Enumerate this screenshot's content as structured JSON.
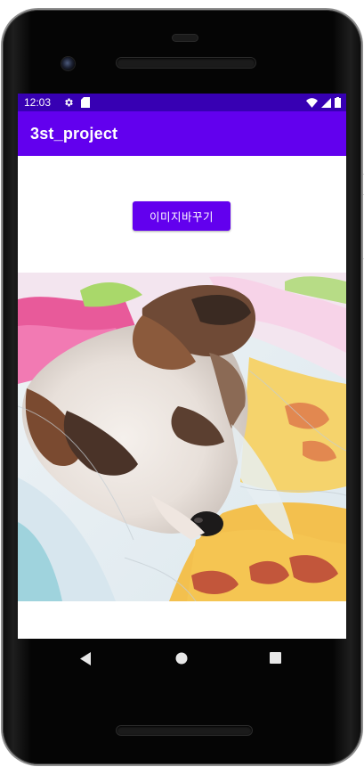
{
  "status_bar": {
    "time": "12:03",
    "background": "#3700b3",
    "icons": [
      "settings-icon",
      "sd-card-icon",
      "wifi-icon",
      "signal-icon",
      "battery-icon"
    ]
  },
  "app_bar": {
    "title": "3st_project",
    "background": "#6200ee"
  },
  "main": {
    "change_image_button_label": "이미지바꾸기",
    "image": "puppy-photo"
  },
  "nav_bar": {
    "icons": [
      "back-icon",
      "home-icon",
      "recent-apps-icon"
    ]
  },
  "colors": {
    "primary": "#6200ee",
    "primary_dark": "#3700b3"
  }
}
